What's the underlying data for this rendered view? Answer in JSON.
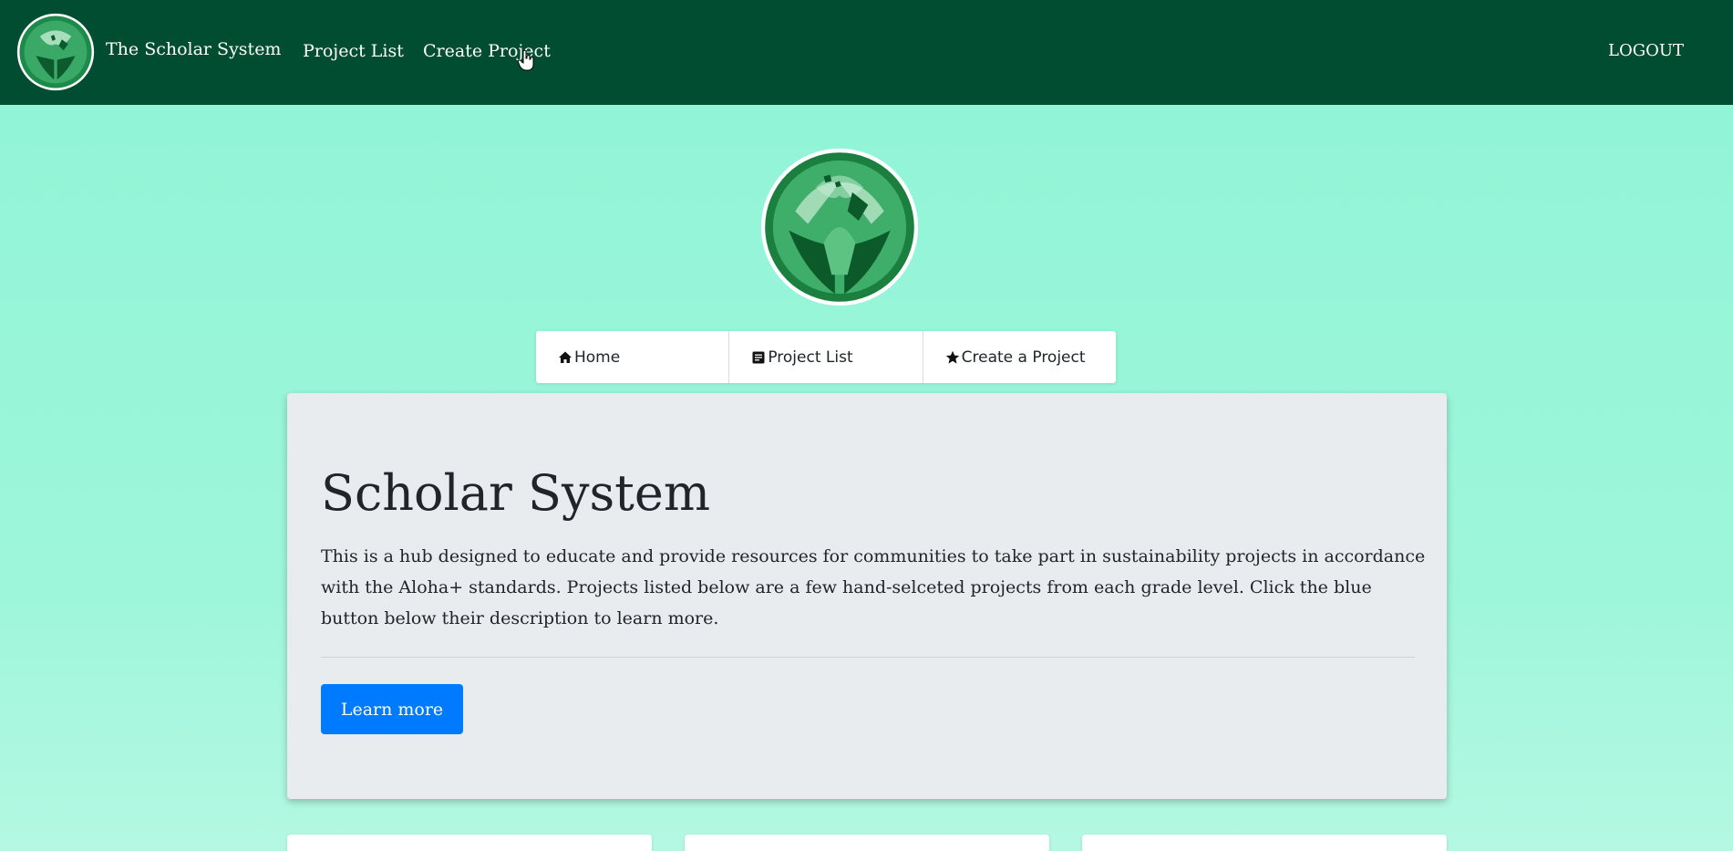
{
  "navbar": {
    "brand": "The Scholar System",
    "links": {
      "project_list": "Project List",
      "create_project": "Create Project",
      "logout": "LOGOUT"
    }
  },
  "menu": {
    "items": [
      {
        "label": "Home",
        "icon": "home-icon"
      },
      {
        "label": "Project List",
        "icon": "list-icon"
      },
      {
        "label": "Create a Project",
        "icon": "star-icon"
      }
    ]
  },
  "jumbotron": {
    "title": "Scholar System",
    "description": "This is a hub designed to educate and provide resources for communities to take part in sustainability projects in accordance with the Aloha+ standards. Projects listed below are a few hand-selceted projects from each grade level. Click the blue button below their description to learn more.",
    "button_label": "Learn more"
  },
  "colors": {
    "navbar_bg": "#004d31",
    "page_bg": "#8ff4d6",
    "primary_button": "#007bff",
    "jumbotron_bg": "#e9ecef"
  }
}
